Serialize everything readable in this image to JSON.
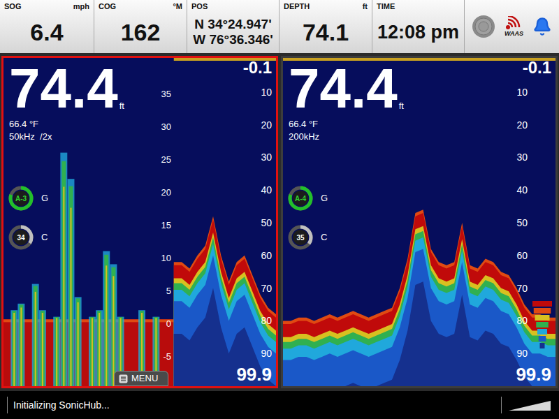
{
  "top_bar": {
    "fields": [
      {
        "label": "SOG",
        "unit": "mph",
        "lines": [
          "6.4"
        ]
      },
      {
        "label": "COG",
        "unit": "°M",
        "lines": [
          "162"
        ]
      },
      {
        "label": "POS",
        "lines": [
          "N 34°24.947'",
          "W 76°36.346'"
        ]
      },
      {
        "label": "DEPTH",
        "unit": "ft",
        "lines": [
          "74.1"
        ]
      },
      {
        "label": "TIME",
        "lines": [
          "12:08 pm"
        ]
      }
    ],
    "waas_label": "WAAS"
  },
  "panels": [
    {
      "selected": true,
      "depth": "74.4",
      "depth_unit": "ft",
      "temperature": "66.4 °F",
      "frequency": "50kHz  /2x",
      "gain": {
        "label": "G",
        "value": "A-3",
        "level": 0.8
      },
      "contrast": {
        "label": "C",
        "value": "34",
        "level": 0.34
      },
      "range_top": "-0.1",
      "range_bottom": "99.9",
      "ticks": [
        "10",
        "20",
        "30",
        "40",
        "50",
        "60",
        "70",
        "80",
        "90"
      ],
      "zoom": {
        "ticks": [
          "35",
          "30",
          "25",
          "20",
          "15",
          "10",
          "5",
          "0",
          "-5"
        ],
        "targets": [
          0,
          2,
          3,
          0,
          6,
          2,
          0,
          1,
          26,
          22,
          4,
          0,
          1,
          2,
          11,
          9,
          1,
          0,
          0,
          2,
          0,
          1,
          0,
          0
        ]
      },
      "bottom": [
        62,
        62,
        64,
        60,
        57,
        48,
        60,
        68,
        62,
        60,
        66,
        72,
        76,
        78
      ],
      "menu": "MENU",
      "color_legend": false
    },
    {
      "selected": false,
      "depth": "74.4",
      "depth_unit": "ft",
      "temperature": "66.4 °F",
      "frequency": "200kHz",
      "gain": {
        "label": "G",
        "value": "A-4",
        "level": 0.8
      },
      "contrast": {
        "label": "C",
        "value": "35",
        "level": 0.35
      },
      "range_top": "-0.1",
      "range_bottom": "99.9",
      "ticks": [
        "10",
        "20",
        "30",
        "40",
        "50",
        "60",
        "70",
        "80",
        "90"
      ],
      "bottom": [
        80,
        80,
        79,
        79,
        80,
        79,
        78,
        79,
        78,
        77,
        78,
        79,
        78,
        77,
        76,
        70,
        61,
        47,
        46,
        58,
        62,
        63,
        62,
        50,
        63,
        64,
        61,
        62,
        65,
        66,
        70,
        75,
        78,
        78,
        79,
        79
      ],
      "color_legend": true
    }
  ],
  "status_bar": {
    "message": "Initializing SonicHub..."
  }
}
